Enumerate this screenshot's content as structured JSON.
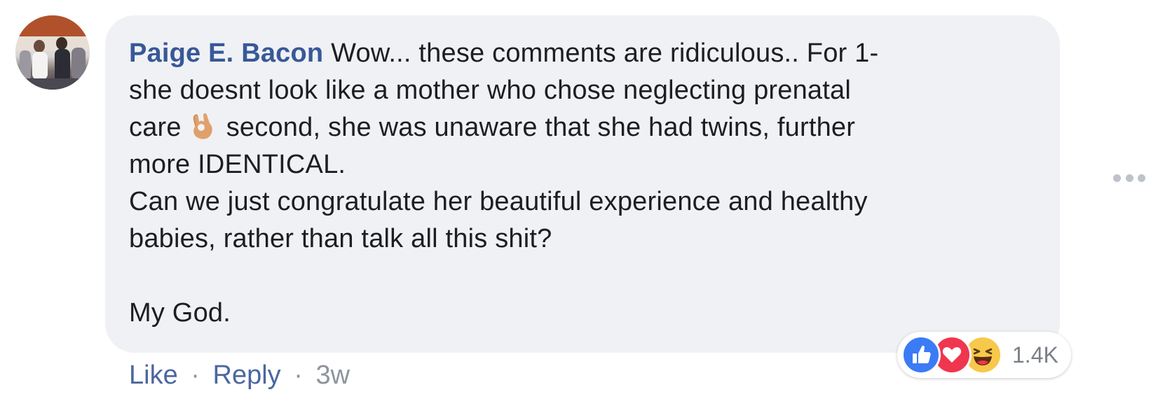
{
  "comment": {
    "author": "Paige E. Bacon",
    "lines": [
      "Wow... these comments are ridiculous.. For 1-",
      "she doesnt look like a mother who chose neglecting prenatal",
      "care",
      "second, she was unaware that she had twins, further",
      "more IDENTICAL.",
      "Can we just congratulate her beautiful experience and healthy",
      "babies, rather than talk all this shit?",
      "My God."
    ],
    "emoji_icon": "ok-hand-emoji"
  },
  "actions": {
    "like_label": "Like",
    "separator": "·",
    "reply_label": "Reply",
    "timestamp": "3w"
  },
  "reactions": {
    "icons": [
      "like-icon",
      "love-icon",
      "haha-icon"
    ],
    "count": "1.4K",
    "colors": {
      "like": "#3b7bf6",
      "love": "#f0364f",
      "haha": "#f7c84a"
    }
  },
  "colors": {
    "author_link": "#385898",
    "action_link": "#4b67a1",
    "bubble_bg": "#f0f1f4",
    "muted": "#8d949e"
  }
}
